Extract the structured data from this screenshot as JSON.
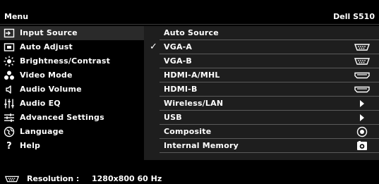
{
  "header": {
    "title": "Menu",
    "model": "Dell S510"
  },
  "left_menu": {
    "selected_index": 0,
    "items": [
      {
        "label": "Input Source",
        "icon": "input-source-icon"
      },
      {
        "label": "Auto Adjust",
        "icon": "auto-adjust-icon"
      },
      {
        "label": "Brightness/Contrast",
        "icon": "brightness-icon"
      },
      {
        "label": "Video Mode",
        "icon": "video-mode-icon"
      },
      {
        "label": "Audio Volume",
        "icon": "speaker-icon"
      },
      {
        "label": "Audio EQ",
        "icon": "equalizer-icon"
      },
      {
        "label": "Advanced Settings",
        "icon": "settings-sliders-icon"
      },
      {
        "label": "Language",
        "icon": "globe-icon"
      },
      {
        "label": "Help",
        "icon": "question-icon"
      }
    ]
  },
  "right_menu": {
    "items": [
      {
        "label": "Auto Source",
        "checked": false,
        "icon": ""
      },
      {
        "label": "VGA-A",
        "checked": true,
        "icon": "vga-port-icon"
      },
      {
        "label": "VGA-B",
        "checked": false,
        "icon": "vga-port-icon"
      },
      {
        "label": "HDMI-A/MHL",
        "checked": false,
        "icon": "hdmi-port-icon"
      },
      {
        "label": "HDMI-B",
        "checked": false,
        "icon": "hdmi-port-icon"
      },
      {
        "label": "Wireless/LAN",
        "checked": false,
        "icon": "arrow-right-icon"
      },
      {
        "label": "USB",
        "checked": false,
        "icon": "arrow-right-icon"
      },
      {
        "label": "Composite",
        "checked": false,
        "icon": "composite-port-icon"
      },
      {
        "label": "Internal Memory",
        "checked": false,
        "icon": "internal-memory-icon"
      }
    ],
    "check_glyph": "✓"
  },
  "footer": {
    "label": "Resolution :",
    "value": "1280x800 60 Hz",
    "icon": "vga-port-icon"
  }
}
